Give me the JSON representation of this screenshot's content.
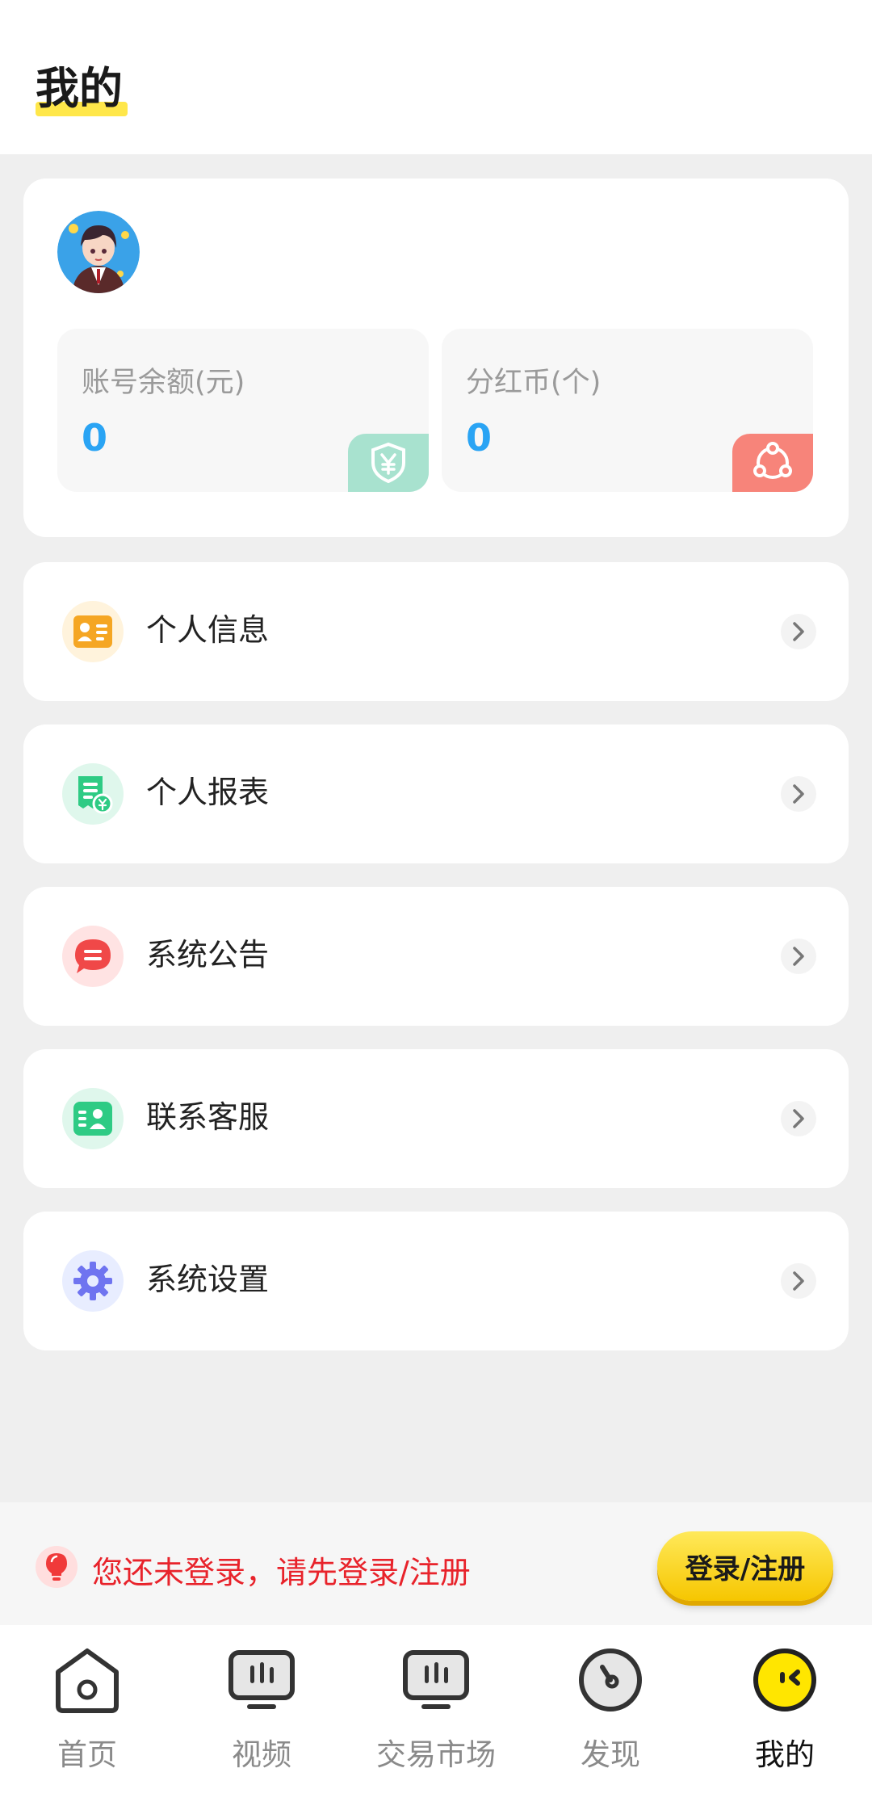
{
  "header": {
    "title": "我的"
  },
  "profile": {
    "avatar": "avatar-image",
    "balance": {
      "label": "账号余额(元)",
      "value": "0",
      "icon": "yuan-shield-icon",
      "color": "#a8e2cf"
    },
    "dividend": {
      "label": "分红币(个)",
      "value": "0",
      "icon": "share-network-icon",
      "color": "#f7847a"
    }
  },
  "menu": [
    {
      "label": "个人信息",
      "icon": "id-card-icon"
    },
    {
      "label": "个人报表",
      "icon": "report-icon"
    },
    {
      "label": "系统公告",
      "icon": "announcement-icon"
    },
    {
      "label": "联系客服",
      "icon": "customer-service-icon"
    },
    {
      "label": "系统设置",
      "icon": "settings-gear-icon"
    }
  ],
  "login": {
    "hint": "您还未登录，请先登录/注册",
    "button": "登录/注册"
  },
  "tabbar": [
    {
      "label": "首页",
      "icon": "home-icon"
    },
    {
      "label": "视频",
      "icon": "video-icon"
    },
    {
      "label": "交易市场",
      "icon": "market-icon"
    },
    {
      "label": "发现",
      "icon": "discover-icon"
    },
    {
      "label": "我的",
      "icon": "mine-icon",
      "active": true
    }
  ]
}
